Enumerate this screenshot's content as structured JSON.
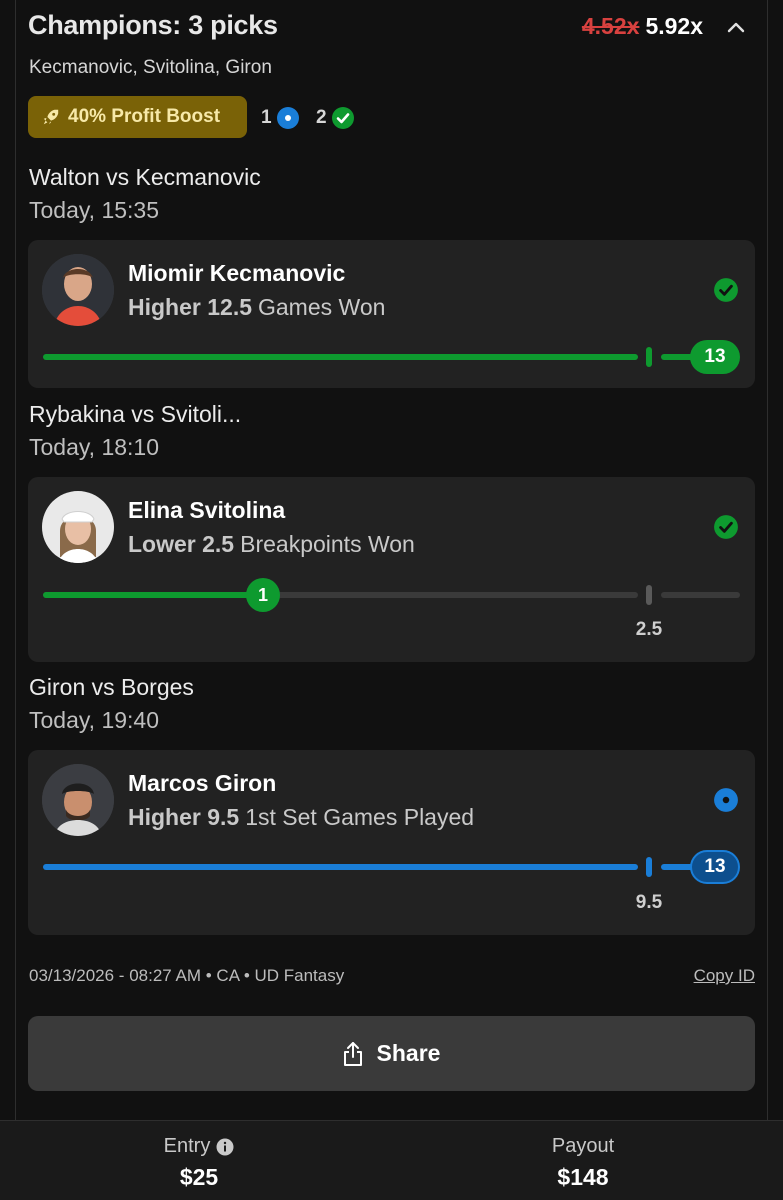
{
  "header": {
    "title": "Champions: 3 picks",
    "multiplier_old": "4.52x",
    "multiplier_new": "5.92x",
    "subtitle": "Kecmanovic, Svitolina, Giron"
  },
  "boost": {
    "label": "40% Profit Boost",
    "icon": "rocket-icon"
  },
  "counts": {
    "pending": "1",
    "won": "2"
  },
  "picks": [
    {
      "match": "Walton vs Kecmanovic",
      "time": "Today, 15:35",
      "player": "Miomir Kecmanovic",
      "direction": "Higher 12.5",
      "stat": "Games Won",
      "status": "won",
      "result": "13",
      "line": "12.5",
      "progress": 1.0
    },
    {
      "match": "Rybakina vs Svitoli...",
      "time": "Today, 18:10",
      "player": "Elina Svitolina",
      "direction": "Lower 2.5",
      "stat": "Breakpoints Won",
      "status": "won",
      "result": "1",
      "line": "2.5",
      "progress": 0.4
    },
    {
      "match": "Giron vs Borges",
      "time": "Today, 19:40",
      "player": "Marcos Giron",
      "direction": "Higher 9.5",
      "stat": "1st Set Games Played",
      "status": "pending",
      "result": "13",
      "line": "9.5",
      "progress": 1.0
    }
  ],
  "footer": {
    "meta": "03/13/2026 - 08:27 AM • CA • UD Fantasy",
    "copy_id": "Copy ID",
    "share": "Share"
  },
  "bottom": {
    "entry_label": "Entry",
    "entry_value": "$25",
    "payout_label": "Payout",
    "payout_value": "$148"
  },
  "colors": {
    "green": "#0e9a2f",
    "blue": "#1a7ed8",
    "red": "#d8413f",
    "boost_bg": "#7a6207"
  }
}
